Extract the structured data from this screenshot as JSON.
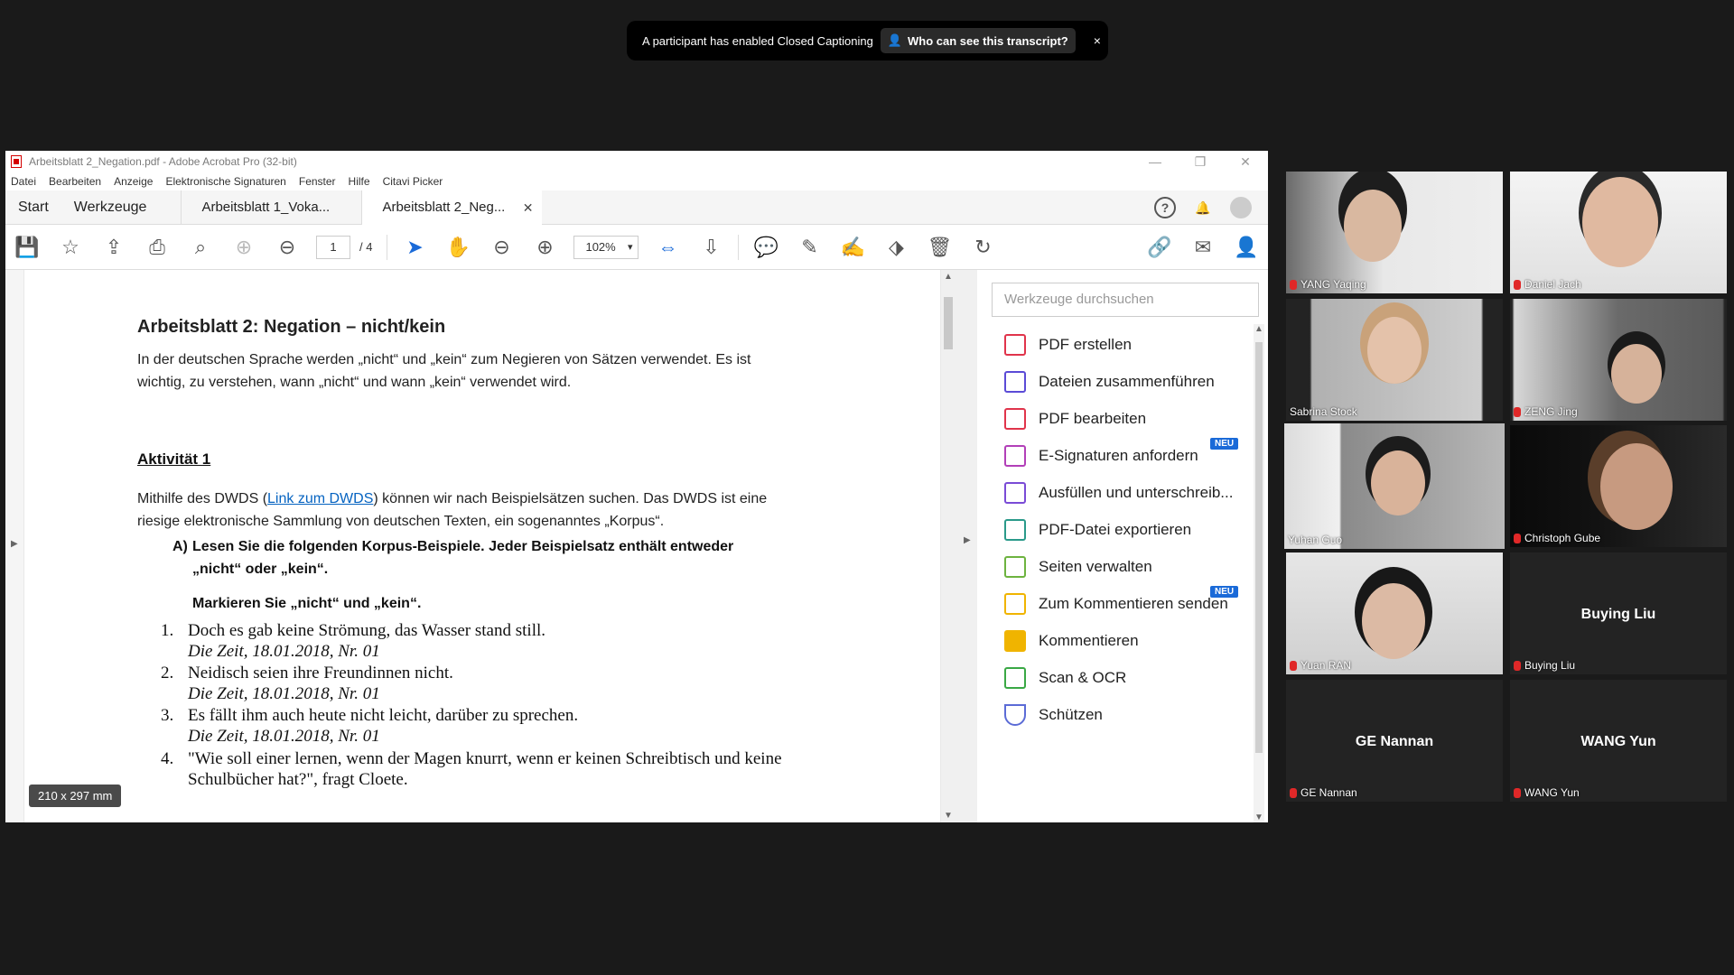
{
  "toast": {
    "message": "A participant has enabled Closed Captioning",
    "button": "Who can see this transcript?",
    "close": "×"
  },
  "acrobat": {
    "title": "Arbeitsblatt 2_Negation.pdf - Adobe Acrobat Pro (32-bit)",
    "menu": [
      "Datei",
      "Bearbeiten",
      "Anzeige",
      "Elektronische Signaturen",
      "Fenster",
      "Hilfe",
      "Citavi Picker"
    ],
    "nav": {
      "start": "Start",
      "tools": "Werkzeuge"
    },
    "tabs": [
      {
        "label": "Arbeitsblatt 1_Voka..."
      },
      {
        "label": "Arbeitsblatt 2_Neg..."
      }
    ],
    "toolbar": {
      "page_current": "1",
      "page_total": "/ 4",
      "zoom": "102%"
    },
    "document": {
      "heading": "Arbeitsblatt 2: Negation – nicht/kein",
      "intro_1": "In der deutschen Sprache werden „nicht“ und „kein“ zum Negieren von Sätzen verwendet. Es ist",
      "intro_2": "wichtig, zu verstehen, wann „nicht“ und wann „kein“ verwendet wird.",
      "activity_title": "Aktivität 1",
      "activity_text_1_pre": "Mithilfe des DWDS (",
      "activity_link": "Link zum DWDS",
      "activity_text_1_post": ") können wir nach Beispielsätzen suchen. Das DWDS ist eine",
      "activity_text_2": "riesige elektronische Sammlung von deutschen Texten, ein sogenanntes „Korpus“.",
      "task_letter": "A)",
      "task_line_1": "Lesen Sie die folgenden Korpus-Beispiele. Jeder Beispielsatz enthält entweder",
      "task_line_2": "„nicht“ oder „kein“.",
      "task_line_3": "Markieren Sie „nicht“ und „kein“.",
      "examples": [
        {
          "num": "1.",
          "text": "Doch es gab keine Strömung, das Wasser stand still.",
          "source": "Die Zeit, 18.01.2018, Nr. 01"
        },
        {
          "num": "2.",
          "text": "Neidisch seien ihre Freundinnen nicht.",
          "source": "Die Zeit, 18.01.2018, Nr. 01"
        },
        {
          "num": "3.",
          "text": "Es fällt ihm auch heute nicht leicht, darüber zu sprechen.",
          "source": "Die Zeit, 18.01.2018, Nr. 01"
        },
        {
          "num": "4.",
          "text": "\"Wie soll einer lernen, wenn der Magen knurrt, wenn er keinen Schreibtisch und keine",
          "source": "Schulbücher hat?\", fragt Cloete."
        }
      ],
      "page_size": "210 x 297 mm"
    },
    "tools_panel": {
      "search_placeholder": "Werkzeuge durchsuchen",
      "items": [
        {
          "label": "PDF erstellen",
          "color": "#e0344b"
        },
        {
          "label": "Dateien zusammenführen",
          "color": "#5b4bd6"
        },
        {
          "label": "PDF bearbeiten",
          "color": "#e0344b"
        },
        {
          "label": "E-Signaturen anfordern",
          "color": "#b23fb8",
          "badge": "NEU"
        },
        {
          "label": "Ausfüllen und unterschreib...",
          "color": "#7a4bd6"
        },
        {
          "label": "PDF-Datei exportieren",
          "color": "#2a9a8a"
        },
        {
          "label": "Seiten verwalten",
          "color": "#6db33f"
        },
        {
          "label": "Zum Kommentieren senden",
          "color": "#f0b400",
          "badge": "NEU"
        },
        {
          "label": "Kommentieren",
          "color": "#f0b400"
        },
        {
          "label": "Scan & OCR",
          "color": "#3aa845"
        },
        {
          "label": "Schützen",
          "color": "#5b6bd6"
        }
      ]
    }
  },
  "participants": [
    {
      "name": "YANG Yaqing",
      "muted": true,
      "video": true
    },
    {
      "name": "Daniel Jach",
      "muted": true,
      "video": true
    },
    {
      "name": "Sabrina Stock",
      "muted": false,
      "video": true
    },
    {
      "name": "ZENG Jing",
      "muted": true,
      "video": true
    },
    {
      "name": "Yuhan Guo",
      "muted": false,
      "video": true,
      "active": true
    },
    {
      "name": "Christoph Gube",
      "muted": true,
      "video": true
    },
    {
      "name": "Yuan RAN",
      "muted": true,
      "video": true
    },
    {
      "name": "Buying Liu",
      "muted": true,
      "video": false
    },
    {
      "name": "GE Nannan",
      "muted": true,
      "video": false
    },
    {
      "name": "WANG Yun",
      "muted": true,
      "video": false
    }
  ]
}
